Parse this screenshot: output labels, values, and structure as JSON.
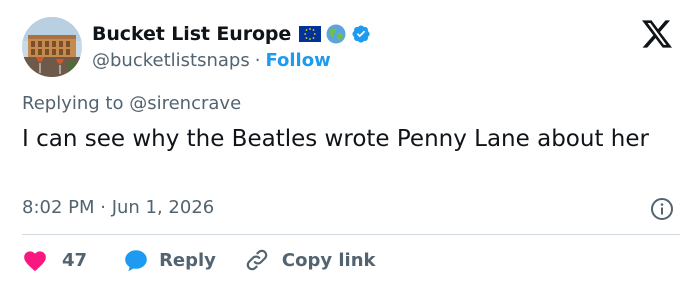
{
  "author": {
    "display_name": "Bucket List Europe",
    "handle": "@bucketlistsnaps",
    "separator": "·",
    "follow_label": "Follow",
    "badges": [
      "eu-flag-icon",
      "globe-icon",
      "verified-icon"
    ],
    "verified_color": "#1d9bf0"
  },
  "reply_context": {
    "prefix": "Replying to",
    "mention": "@sirencrave"
  },
  "tweet": {
    "text": "I can see why the Beatles wrote Penny Lane about her",
    "timestamp": "8:02 PM · Jun 1, 2026"
  },
  "actions": {
    "like_count": "47",
    "reply_label": "Reply",
    "copy_link_label": "Copy link"
  },
  "colors": {
    "accent": "#1d9bf0",
    "like": "#f91880",
    "text": "#0f1419",
    "secondary": "#536471"
  }
}
